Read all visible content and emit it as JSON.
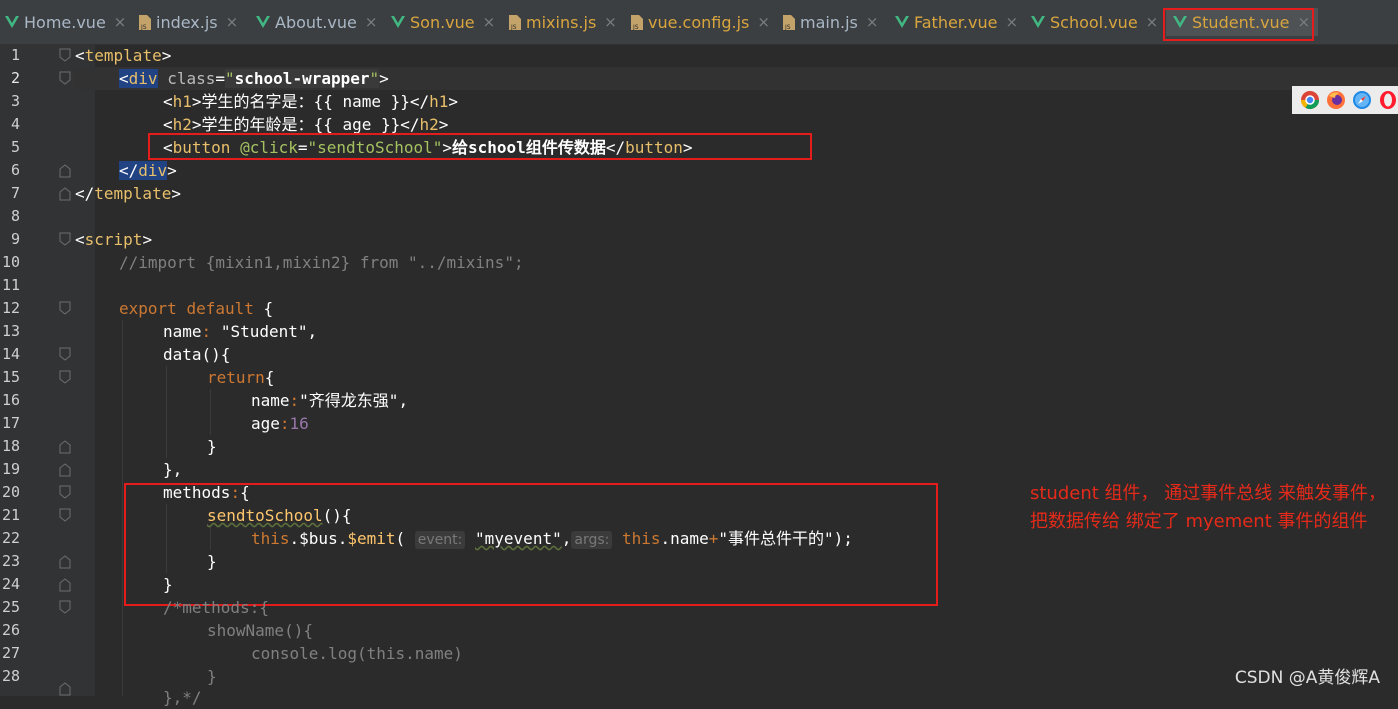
{
  "tabs": [
    {
      "label": "Home.vue",
      "type": "vue"
    },
    {
      "label": "index.js",
      "type": "js"
    },
    {
      "label": "About.vue",
      "type": "vue"
    },
    {
      "label": "Son.vue",
      "type": "vue"
    },
    {
      "label": "mixins.js",
      "type": "js"
    },
    {
      "label": "vue.config.js",
      "type": "js"
    },
    {
      "label": "main.js",
      "type": "js"
    },
    {
      "label": "Father.vue",
      "type": "vue"
    },
    {
      "label": "School.vue",
      "type": "vue"
    },
    {
      "label": "Student.vue",
      "type": "vue",
      "active": true
    }
  ],
  "close_glyph": "×",
  "line_numbers": [
    "1",
    "2",
    "3",
    "4",
    "5",
    "6",
    "7",
    "8",
    "9",
    "10",
    "11",
    "12",
    "13",
    "14",
    "15",
    "16",
    "17",
    "18",
    "19",
    "20",
    "21",
    "22",
    "23",
    "24",
    "25",
    "26",
    "27",
    "28"
  ],
  "code": {
    "l1_open": "<",
    "l1_tag": "template",
    "l1_close": ">",
    "l2_lt": "<",
    "l2_tag": "div",
    "l2_attr": "class",
    "l2_eq": "=",
    "l2_q1": "\"",
    "l2_val": "school-wrapper",
    "l2_q2": "\"",
    "l2_gt": ">",
    "l3_lt": "<",
    "l3_tag": "h1",
    "l3_gt": ">",
    "l3_text": "学生的名字是：",
    "l3_mus": "{{ name }}",
    "l3_lt2": "</",
    "l3_tag2": "h1",
    "l3_gt2": ">",
    "l4_lt": "<",
    "l4_tag": "h2",
    "l4_gt": ">",
    "l4_text": "学生的年龄是：",
    "l4_mus": "{{ age }}",
    "l4_lt2": "</",
    "l4_tag2": "h2",
    "l4_gt2": ">",
    "l5_lt": "<",
    "l5_tag": "button",
    "l5_attr": "@click",
    "l5_eq": "=",
    "l5_val": "\"sendtoSchool\"",
    "l5_gt": ">",
    "l5_text": "给school组件传数据",
    "l5_lt2": "</",
    "l5_tag2": "button",
    "l5_gt2": ">",
    "l6_lt": "</",
    "l6_tag": "div",
    "l6_gt": ">",
    "l7_lt": "</",
    "l7_tag": "template",
    "l7_gt": ">",
    "l9_lt": "<",
    "l9_tag": "script",
    "l9_gt": ">",
    "l10_comment": "//import {mixin1,mixin2} from \"../mixins\";",
    "l12_k1": "export",
    "l12_k2": "default",
    "l12_brace": " {",
    "l13_key": "name",
    "l13_colon": ":",
    "l13_val": "\"Student\"",
    "l13_comma": ",",
    "l14_fn": "data(){",
    "l15_k": "return",
    "l15_brace": "{",
    "l16_key": "name",
    "l16_colon": ":",
    "l16_val": "\"齐得龙东强\"",
    "l16_comma": ",",
    "l17_key": "age",
    "l17_colon": ":",
    "l17_val": "16",
    "l18_brace": "}",
    "l19_brace": "},",
    "l20_key": "methods",
    "l20_colon": ":",
    "l20_brace": "{",
    "l21_fn": "sendtoSchool",
    "l21_rest": "(){",
    "l22_this": "this",
    "l22_bus": ".$bus.",
    "l22_emit": "$emit",
    "l22_paren": "(",
    "l22_hint1": "event:",
    "l22_ev": "\"myevent\"",
    "l22_comma": ",",
    "l22_hint2": "args:",
    "l22_this2": "this",
    "l22_name": ".name",
    "l22_plus": "+",
    "l22_str": "\"事件总件干的\"",
    "l22_end": ");",
    "l23_brace": "}",
    "l24_brace": "}",
    "l25_comment": "/*methods:{",
    "l26_comment": "showName(){",
    "l27_comment": "console.log(this.name)",
    "l28_comment": "}",
    "l29_comment": "},*/"
  },
  "annotation": "student 组件， 通过事件总线 来触发事件， 把数据传给 绑定了 myement 事件的组件",
  "watermark": "CSDN @A黄俊辉A",
  "browser_icons": [
    "chrome-icon",
    "firefox-icon",
    "safari-icon",
    "opera-icon"
  ],
  "colors": {
    "tag": "#e8bf6a",
    "keyword": "#cc7832",
    "string": "#6a8759",
    "number": "#6897bb",
    "annotation": "#e52a1a"
  }
}
